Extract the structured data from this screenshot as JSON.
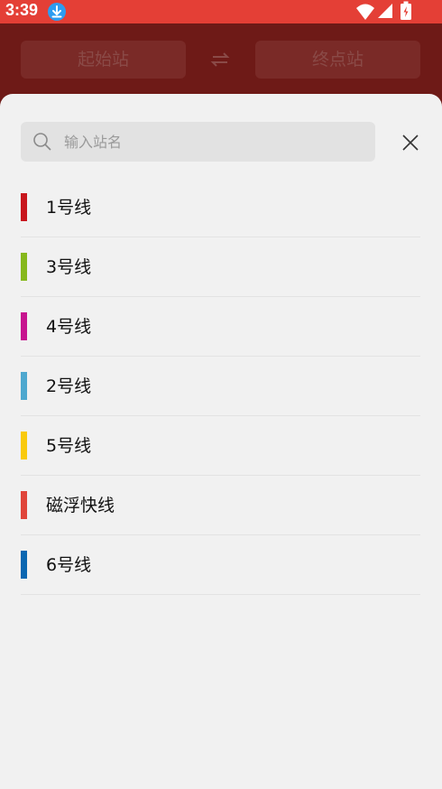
{
  "status_bar": {
    "time": "3:39",
    "icons": [
      "download-icon",
      "wifi-icon",
      "signal-icon",
      "battery-charging-icon"
    ]
  },
  "route_bar": {
    "start_label": "起始站",
    "end_label": "终点站",
    "swap_icon": "swap-icon"
  },
  "sheet": {
    "search_placeholder": "输入站名",
    "search_value": "",
    "close_icon": "close-icon",
    "lines": [
      {
        "label": "1号线",
        "color": "#c8161d"
      },
      {
        "label": "3号线",
        "color": "#86b81c"
      },
      {
        "label": "4号线",
        "color": "#c7148f"
      },
      {
        "label": "2号线",
        "color": "#4ea8cf"
      },
      {
        "label": "5号线",
        "color": "#f9ca0c"
      },
      {
        "label": "磁浮快线",
        "color": "#e0453a"
      },
      {
        "label": "6号线",
        "color": "#0a67b1"
      }
    ]
  },
  "colors": {
    "status_bar": "#e43f36",
    "header_dim": "#6e1a17",
    "sheet_bg": "#f1f1f1"
  }
}
